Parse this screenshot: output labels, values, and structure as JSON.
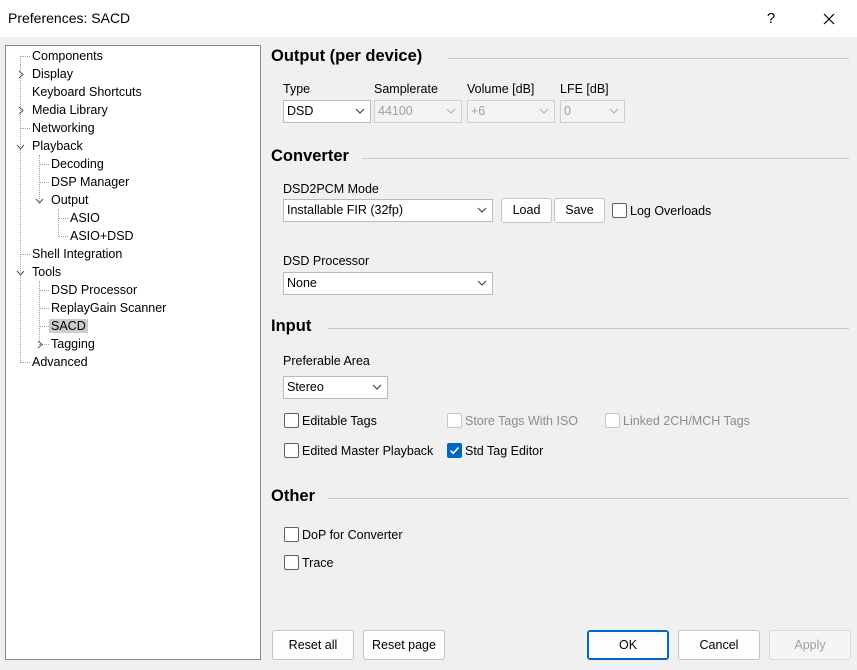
{
  "window": {
    "title": "Preferences: SACD",
    "help_label": "?"
  },
  "tree": {
    "items": [
      {
        "label": "Components"
      },
      {
        "label": "Display"
      },
      {
        "label": "Keyboard Shortcuts"
      },
      {
        "label": "Media Library"
      },
      {
        "label": "Networking"
      },
      {
        "label": "Playback"
      },
      {
        "label": "Decoding"
      },
      {
        "label": "DSP Manager"
      },
      {
        "label": "Output"
      },
      {
        "label": "ASIO"
      },
      {
        "label": "ASIO+DSD"
      },
      {
        "label": "Shell Integration"
      },
      {
        "label": "Tools"
      },
      {
        "label": "DSD Processor"
      },
      {
        "label": "ReplayGain Scanner"
      },
      {
        "label": "SACD",
        "selected": true
      },
      {
        "label": "Tagging"
      },
      {
        "label": "Advanced"
      }
    ]
  },
  "output": {
    "title": "Output (per device)",
    "type_label": "Type",
    "type_value": "DSD",
    "samplerate_label": "Samplerate",
    "samplerate_value": "44100",
    "volume_label": "Volume [dB]",
    "volume_value": "+6",
    "lfe_label": "LFE [dB]",
    "lfe_value": "0"
  },
  "converter": {
    "title": "Converter",
    "mode_label": "DSD2PCM Mode",
    "mode_value": "Installable FIR (32fp)",
    "load_label": "Load",
    "save_label": "Save",
    "log_overloads_label": "Log Overloads",
    "log_overloads_checked": false,
    "processor_label": "DSD Processor",
    "processor_value": "None"
  },
  "input": {
    "title": "Input",
    "area_label": "Preferable Area",
    "area_value": "Stereo",
    "editable_tags_label": "Editable Tags",
    "editable_tags_checked": false,
    "store_tags_label": "Store Tags With ISO",
    "store_tags_checked": false,
    "linked_tags_label": "Linked 2CH/MCH Tags",
    "linked_tags_checked": false,
    "edited_master_label": "Edited Master Playback",
    "edited_master_checked": false,
    "std_tag_editor_label": "Std Tag Editor",
    "std_tag_editor_checked": true
  },
  "other": {
    "title": "Other",
    "dop_label": "DoP for Converter",
    "dop_checked": false,
    "trace_label": "Trace",
    "trace_checked": false
  },
  "footer": {
    "reset_all_label": "Reset all",
    "reset_page_label": "Reset page",
    "ok_label": "OK",
    "cancel_label": "Cancel",
    "apply_label": "Apply"
  },
  "colors": {
    "accent": "#0067c0",
    "selection": "#cccccc"
  }
}
